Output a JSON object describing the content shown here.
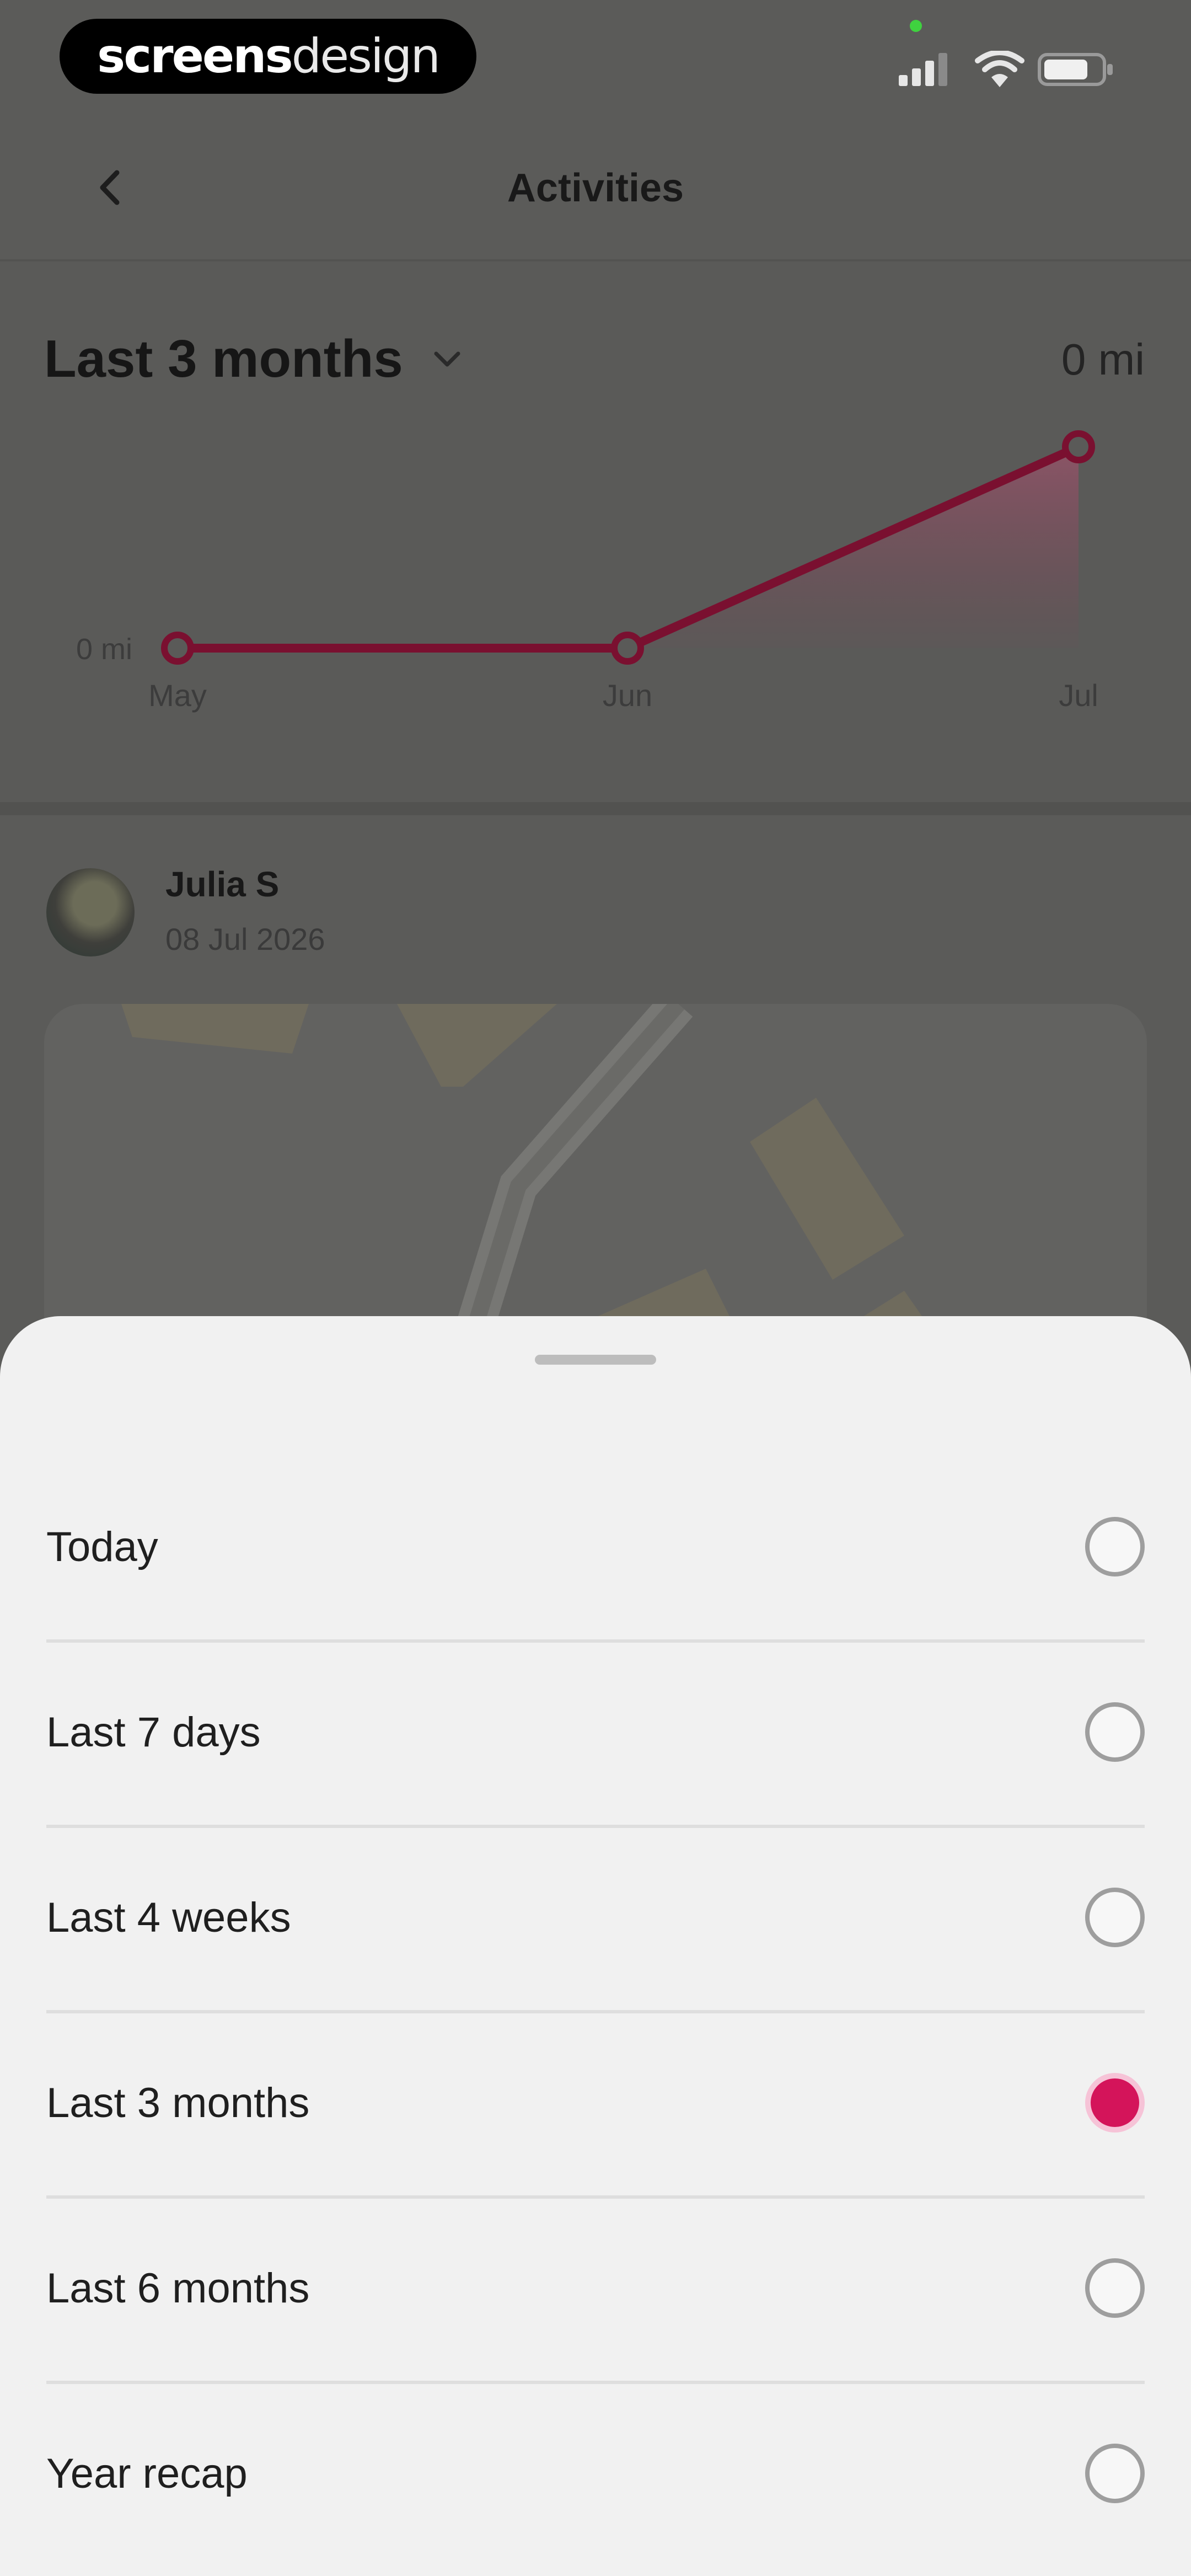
{
  "status_bar": {
    "brand_bold": "screens",
    "brand_light": "design"
  },
  "header": {
    "title": "Activities"
  },
  "summary": {
    "period_label": "Last 3 months",
    "total_distance": "0 mi"
  },
  "chart_data": {
    "type": "line",
    "categories": [
      "May",
      "Jun",
      "Jul"
    ],
    "values": [
      0,
      0,
      1
    ],
    "y_tick_label": "0 mi",
    "color": "#7a1030",
    "fill_color": "#c46a86"
  },
  "post": {
    "author": "Julia S",
    "date": "08 Jul 2026"
  },
  "sheet": {
    "options": [
      {
        "label": "Today",
        "selected": false
      },
      {
        "label": "Last 7 days",
        "selected": false
      },
      {
        "label": "Last 4 weeks",
        "selected": false
      },
      {
        "label": "Last 3 months",
        "selected": true
      },
      {
        "label": "Last 6 months",
        "selected": false
      },
      {
        "label": "Year recap",
        "selected": false
      }
    ]
  },
  "colors": {
    "accent": "#d4145a",
    "overlay": "#5b5b59",
    "sheet_background": "#f1f1f1"
  }
}
